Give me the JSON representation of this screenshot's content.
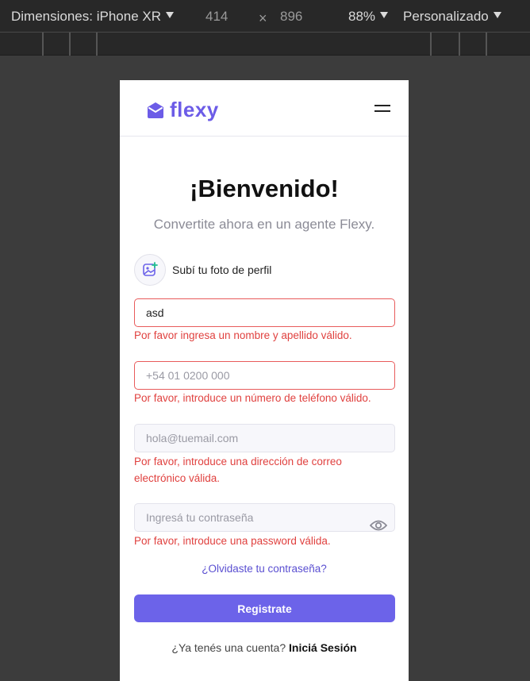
{
  "devtools": {
    "device_label": "Dimensiones: iPhone XR",
    "width": "414",
    "times": "×",
    "height": "896",
    "zoom": "88%",
    "throttle": "Personalizado"
  },
  "header": {
    "logo_text": "flexy",
    "brand_color": "#6c5ce7"
  },
  "main": {
    "title": "¡Bienvenido!",
    "subtitle": "Convertite ahora en un agente Flexy.",
    "photo_label": "Subí tu foto de perfil"
  },
  "form": {
    "name": {
      "value": "asd",
      "error": "Por favor ingresa un nombre y apellido válido."
    },
    "phone": {
      "placeholder": "+54 01 0200 000",
      "error": "Por favor, introduce un número de teléfono válido."
    },
    "email": {
      "placeholder": "hola@tuemail.com",
      "error": "Por favor, introduce una dirección de correo electrónico válida."
    },
    "password": {
      "placeholder": "Ingresá tu contraseña",
      "error": "Por favor, introduce una password válida."
    },
    "forgot_label": "¿Olvidaste tu contraseña?",
    "submit_label": "Registrate"
  },
  "footer": {
    "question": "¿Ya tenés una cuenta?",
    "login_link": "Iniciá Sesión"
  },
  "colors": {
    "error": "#e0413f",
    "primary_button": "#6c63e9"
  }
}
